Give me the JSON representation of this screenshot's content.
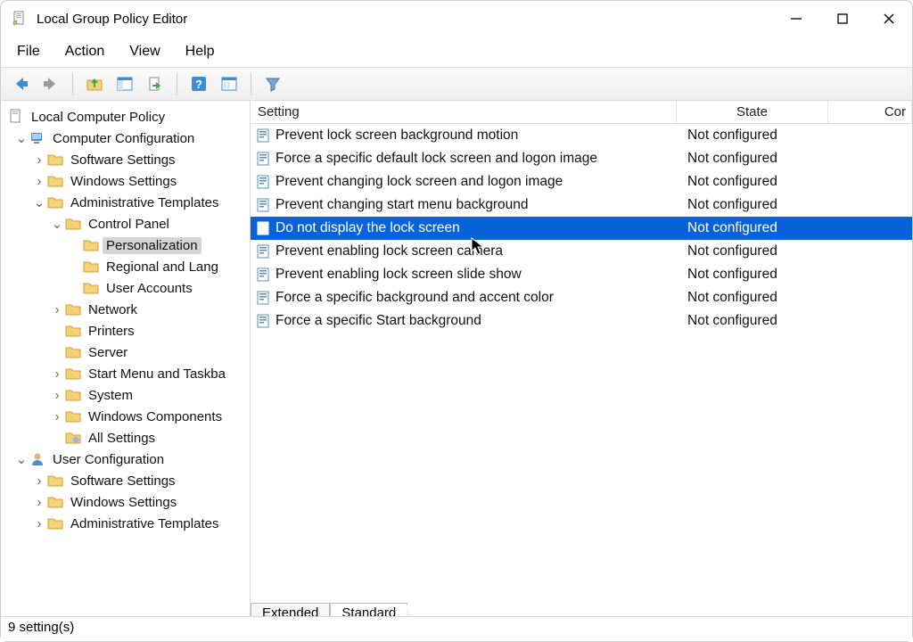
{
  "window": {
    "title": "Local Group Policy Editor"
  },
  "menu": {
    "file": "File",
    "action": "Action",
    "view": "View",
    "help": "Help"
  },
  "tree": {
    "root": "Local Computer Policy",
    "computer_config": "Computer Configuration",
    "cc_software": "Software Settings",
    "cc_windows": "Windows Settings",
    "cc_admin": "Administrative Templates",
    "control_panel": "Control Panel",
    "personalization": "Personalization",
    "regional": "Regional and Lang",
    "user_accounts": "User Accounts",
    "network": "Network",
    "printers": "Printers",
    "server": "Server",
    "start_menu": "Start Menu and Taskba",
    "system": "System",
    "win_components": "Windows Components",
    "all_settings": "All Settings",
    "user_config": "User Configuration",
    "uc_software": "Software Settings",
    "uc_windows": "Windows Settings",
    "uc_admin": "Administrative Templates"
  },
  "columns": {
    "setting": "Setting",
    "state": "State",
    "comment": "Cor"
  },
  "settings": [
    {
      "name": "Prevent lock screen background motion",
      "state": "Not configured"
    },
    {
      "name": "Force a specific default lock screen and logon image",
      "state": "Not configured"
    },
    {
      "name": "Prevent changing lock screen and logon image",
      "state": "Not configured"
    },
    {
      "name": "Prevent changing start menu background",
      "state": "Not configured"
    },
    {
      "name": "Do not display the lock screen",
      "state": "Not configured"
    },
    {
      "name": "Prevent enabling lock screen camera",
      "state": "Not configured"
    },
    {
      "name": "Prevent enabling lock screen slide show",
      "state": "Not configured"
    },
    {
      "name": "Force a specific background and accent color",
      "state": "Not configured"
    },
    {
      "name": "Force a specific Start background",
      "state": "Not configured"
    }
  ],
  "tabs": {
    "extended": "Extended",
    "standard": "Standard"
  },
  "status": "9 setting(s)"
}
